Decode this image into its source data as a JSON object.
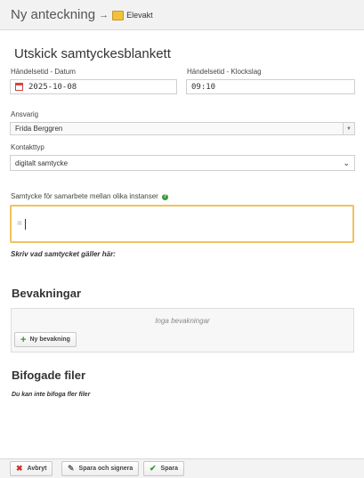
{
  "header": {
    "title": "Ny anteckning",
    "arrow": "→",
    "breadcrumb": "Elevakt"
  },
  "form": {
    "section_title": "Utskick samtyckesblankett",
    "date_label": "Händelsetid - Datum",
    "date_value": "2025-10-08",
    "time_label": "Händelsetid - Klockslag",
    "time_value": "09:10",
    "responsible_label": "Ansvarig",
    "responsible_value": "Frida Berggren",
    "contact_label": "Kontakttyp",
    "contact_value": "digitalt samtycke",
    "consent_label": "Samtycke för samarbete mellan olika instanser",
    "consent_value": "=",
    "consent_hint": "Skriv vad samtycket gäller här:"
  },
  "watches": {
    "title": "Bevakningar",
    "empty_text": "Inga bevakningar",
    "new_button": "Ny bevakning"
  },
  "attachments": {
    "title": "Bifogade filer",
    "note": "Du kan inte bifoga fler filer"
  },
  "footer": {
    "cancel": "Avbryt",
    "save_sign": "Spara och signera",
    "save": "Spara"
  },
  "colors": {
    "focus_border": "#f1c25c",
    "accent_green": "#2f9a2f",
    "cancel_red": "#d0312d"
  },
  "icons": {
    "breadcrumb": "folder-icon",
    "date": "calendar-icon",
    "help": "help-icon",
    "new_watch": "plus-icon",
    "cancel": "close-icon",
    "save_sign": "pencil-icon",
    "save": "checkmark-icon"
  }
}
